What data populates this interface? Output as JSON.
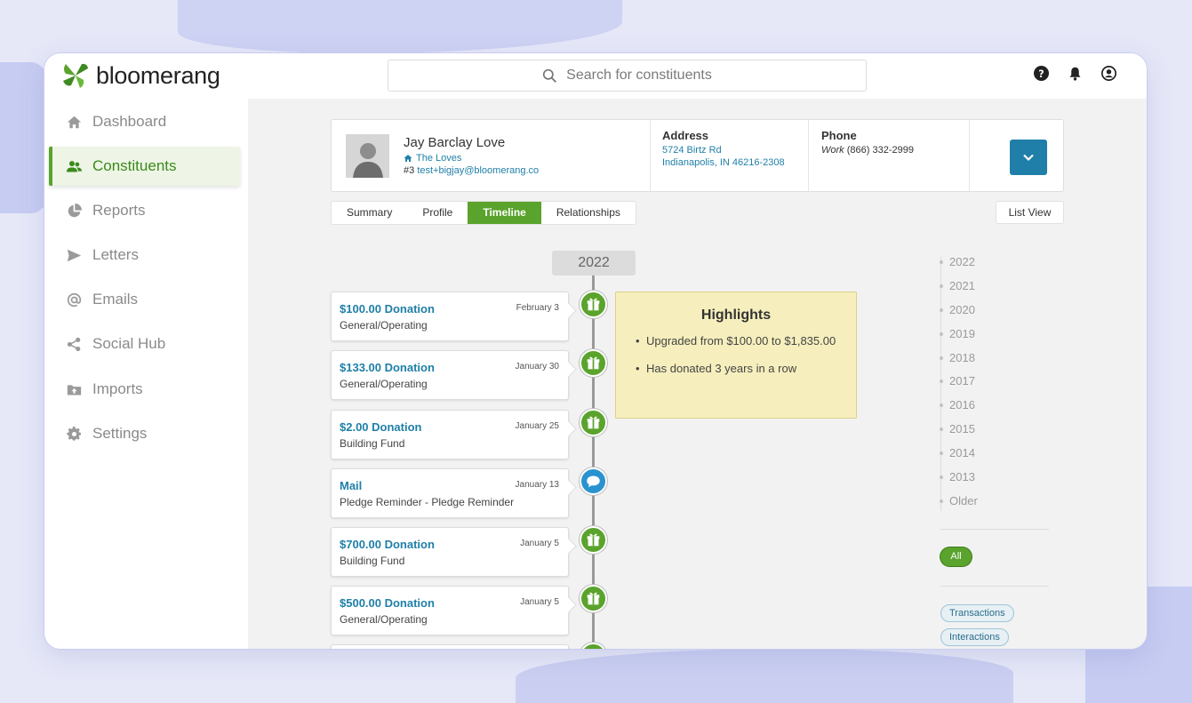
{
  "app": {
    "brand": "bloomerang"
  },
  "search": {
    "placeholder": "Search for constituents"
  },
  "header_icons": [
    "help-icon",
    "bell-icon",
    "account-icon"
  ],
  "sidebar": {
    "items": [
      {
        "label": "Dashboard",
        "icon": "home-icon",
        "active": false
      },
      {
        "label": "Constituents",
        "icon": "users-icon",
        "active": true
      },
      {
        "label": "Reports",
        "icon": "pie-chart-icon",
        "active": false
      },
      {
        "label": "Letters",
        "icon": "send-icon",
        "active": false
      },
      {
        "label": "Emails",
        "icon": "at-icon",
        "active": false
      },
      {
        "label": "Social Hub",
        "icon": "share-icon",
        "active": false
      },
      {
        "label": "Imports",
        "icon": "folder-upload-icon",
        "active": false
      },
      {
        "label": "Settings",
        "icon": "gear-icon",
        "active": false
      }
    ]
  },
  "profile": {
    "name": "Jay Barclay Love",
    "household": "The Loves",
    "id": "#3",
    "email": "test+bigjay@bloomerang.co",
    "address_label": "Address",
    "address_line1": "5724 Birtz Rd",
    "address_line2": "Indianapolis, IN 46216-2308",
    "phone_label": "Phone",
    "phone_type": "Work",
    "phone_number": "(866) 332-2999"
  },
  "tabs": [
    {
      "label": "Summary",
      "active": false
    },
    {
      "label": "Profile",
      "active": false
    },
    {
      "label": "Timeline",
      "active": true
    },
    {
      "label": "Relationships",
      "active": false
    }
  ],
  "list_view_label": "List View",
  "timeline": {
    "year": "2022",
    "events": [
      {
        "title": "$100.00 Donation",
        "date": "February 3",
        "subtitle": "General/Operating",
        "type": "gift"
      },
      {
        "title": "$133.00 Donation",
        "date": "January 30",
        "subtitle": "General/Operating",
        "type": "gift"
      },
      {
        "title": "$2.00 Donation",
        "date": "January 25",
        "subtitle": "Building Fund",
        "type": "gift"
      },
      {
        "title": "Mail",
        "date": "January 13",
        "subtitle": "Pledge Reminder - Pledge Reminder",
        "type": "mail"
      },
      {
        "title": "$700.00 Donation",
        "date": "January 5",
        "subtitle": "Building Fund",
        "type": "gift"
      },
      {
        "title": "$500.00 Donation",
        "date": "January 5",
        "subtitle": "General/Operating",
        "type": "gift"
      }
    ]
  },
  "highlights": {
    "title": "Highlights",
    "items": [
      "Upgraded from $100.00 to $1,835.00",
      "Has donated 3 years in a row"
    ]
  },
  "year_nav": [
    "2022",
    "2021",
    "2020",
    "2019",
    "2018",
    "2017",
    "2016",
    "2015",
    "2014",
    "2013",
    "Older"
  ],
  "filters": {
    "all_label": "All",
    "chips": [
      "Transactions",
      "Interactions"
    ]
  },
  "colors": {
    "accent_green": "#5aa32c",
    "accent_blue": "#1f7fa8",
    "highlight_bg": "#f6efbd"
  }
}
